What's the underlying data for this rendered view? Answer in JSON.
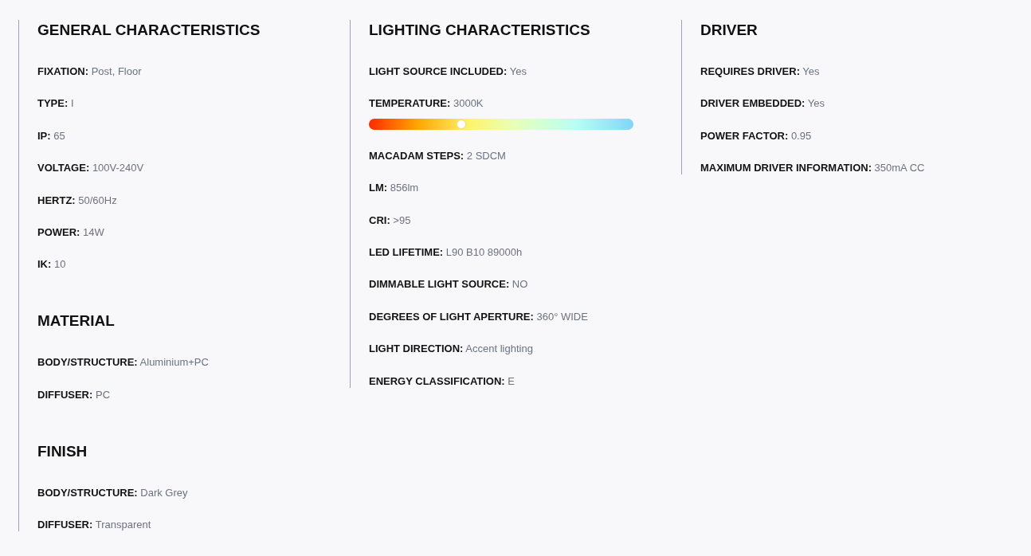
{
  "columns": [
    {
      "sections": [
        {
          "title": "GENERAL CHARACTERISTICS",
          "items": [
            {
              "kind": "text",
              "label": "FIXATION:",
              "value": "Post, Floor"
            },
            {
              "kind": "text",
              "label": "TYPE:",
              "value": "I"
            },
            {
              "kind": "text",
              "label": "IP:",
              "value": "65"
            },
            {
              "kind": "text",
              "label": "VOLTAGE:",
              "value": "100V-240V"
            },
            {
              "kind": "text",
              "label": "HERTZ:",
              "value": "50/60Hz"
            },
            {
              "kind": "text",
              "label": "POWER:",
              "value": "14W"
            },
            {
              "kind": "text",
              "label": "IK:",
              "value": "10"
            }
          ]
        },
        {
          "title": "MATERIAL",
          "items": [
            {
              "kind": "text",
              "label": "BODY/STRUCTURE:",
              "value": "Aluminium+PC"
            },
            {
              "kind": "text",
              "label": "DIFFUSER:",
              "value": "PC"
            }
          ]
        },
        {
          "title": "FINISH",
          "items": [
            {
              "kind": "text",
              "label": "BODY/STRUCTURE:",
              "value": "Dark Grey"
            },
            {
              "kind": "text",
              "label": "DIFFUSER:",
              "value": "Transparent"
            }
          ]
        }
      ]
    },
    {
      "sections": [
        {
          "title": "LIGHTING CHARACTERISTICS",
          "items": [
            {
              "kind": "text",
              "label": "LIGHT SOURCE INCLUDED:",
              "value": "Yes"
            },
            {
              "kind": "scale",
              "label": "TEMPERATURE:",
              "value": "3000K",
              "level": 0.35
            },
            {
              "kind": "text",
              "label": "MACADAM STEPS:",
              "value": "2 SDCM"
            },
            {
              "kind": "text",
              "label": "LM:",
              "value": "856lm"
            },
            {
              "kind": "text",
              "label": "CRI:",
              "value": ">95"
            },
            {
              "kind": "text",
              "label": "LED LIFETIME:",
              "value": "L90 B10 89000h"
            },
            {
              "kind": "text",
              "label": "DIMMABLE LIGHT SOURCE:",
              "value": "NO"
            },
            {
              "kind": "text",
              "label": "DEGREES OF LIGHT APERTURE:",
              "value": "360° WIDE"
            },
            {
              "kind": "text",
              "label": "LIGHT DIRECTION:",
              "value": "Accent lighting"
            },
            {
              "kind": "text",
              "label": "ENERGY CLASSIFICATION:",
              "value": "E"
            }
          ]
        }
      ]
    },
    {
      "sections": [
        {
          "title": "DRIVER",
          "items": [
            {
              "kind": "text",
              "label": "REQUIRES DRIVER:",
              "value": "Yes"
            },
            {
              "kind": "text",
              "label": "DRIVER EMBEDDED:",
              "value": "Yes"
            },
            {
              "kind": "text",
              "label": "POWER FACTOR:",
              "value": "0.95"
            },
            {
              "kind": "text",
              "label": "MAXIMUM DRIVER INFORMATION:",
              "value": "350mA CC"
            }
          ]
        }
      ]
    }
  ]
}
